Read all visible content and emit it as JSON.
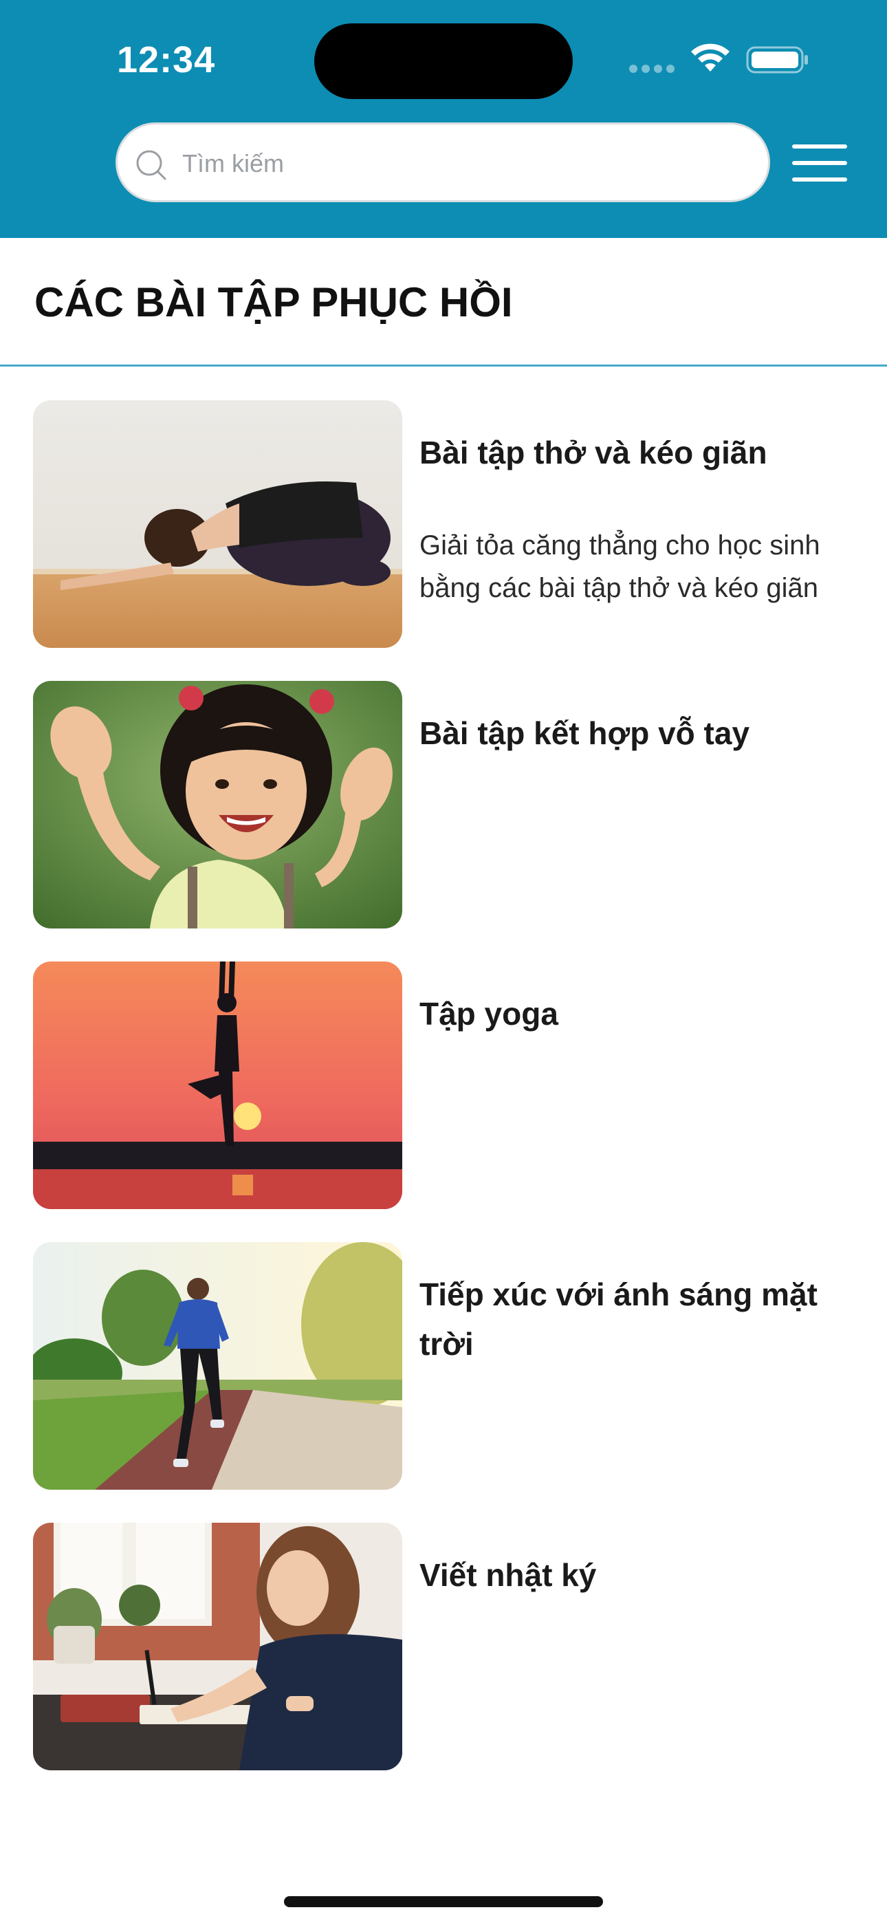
{
  "status_bar": {
    "time": "12:34"
  },
  "header": {
    "background_color": "#0d8db3",
    "search": {
      "placeholder": "Tìm kiếm",
      "value": "",
      "icon": "search-icon"
    },
    "menu_icon": "hamburger-menu-icon"
  },
  "page": {
    "title": "CÁC BÀI TẬP PHỤC HỒI"
  },
  "exercises": [
    {
      "title": "Bài tập thở và kéo giãn",
      "description": "Giải tỏa căng thẳng cho học sinh bằng các bài tập thở và kéo giãn",
      "image": "woman-stretching-child-pose-photo"
    },
    {
      "title": "Bài tập kết hợp vỗ tay",
      "description": "",
      "image": "laughing-girl-clapping-photo"
    },
    {
      "title": "Tập yoga",
      "description": "",
      "image": "yoga-silhouette-sunset-photo"
    },
    {
      "title": "Tiếp xúc với ánh sáng mặt trời",
      "description": "",
      "image": "man-jogging-park-photo"
    },
    {
      "title": "Viết nhật ký",
      "description": "",
      "image": "woman-writing-journal-photo"
    }
  ]
}
